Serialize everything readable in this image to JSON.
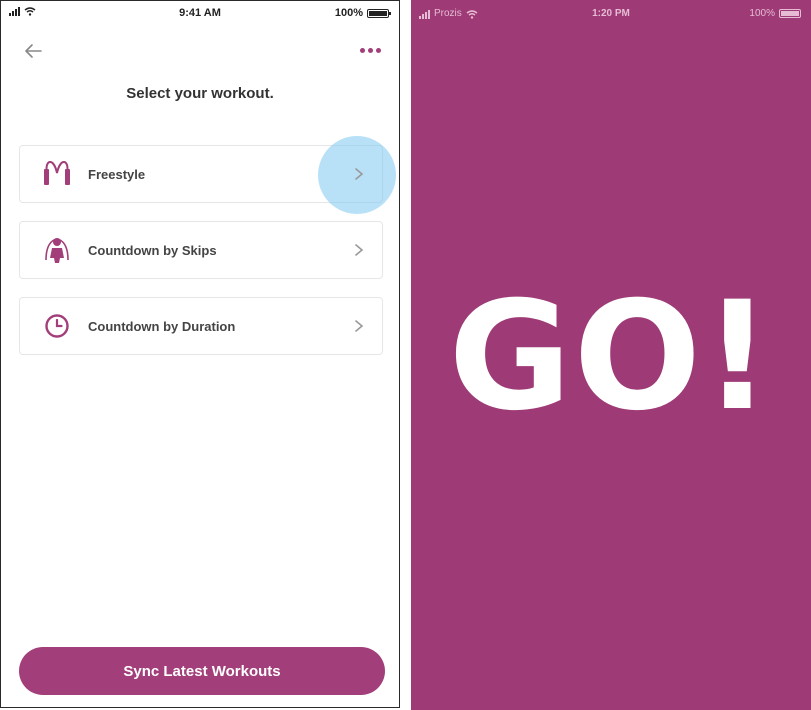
{
  "left_screen": {
    "status_bar": {
      "time": "9:41 AM",
      "battery": "100%"
    },
    "nav": {
      "back_icon": "arrow-left-icon",
      "more_icon": "more-dots-icon"
    },
    "title": "Select your workout.",
    "workouts": [
      {
        "label": "Freestyle",
        "icon": "jump-rope-icon",
        "highlighted": true
      },
      {
        "label": "Countdown by Skips",
        "icon": "person-skipping-icon",
        "highlighted": false
      },
      {
        "label": "Countdown by Duration",
        "icon": "clock-icon",
        "highlighted": false
      }
    ],
    "sync_button_label": "Sync Latest Workouts"
  },
  "right_screen": {
    "status_bar": {
      "carrier": "Prozis",
      "time": "1:20 PM",
      "battery": "100%"
    },
    "message": "GO!"
  },
  "colors": {
    "accent": "#a23e79",
    "go_background": "#9e3a76",
    "tap_highlight": "#7dc8f0"
  }
}
